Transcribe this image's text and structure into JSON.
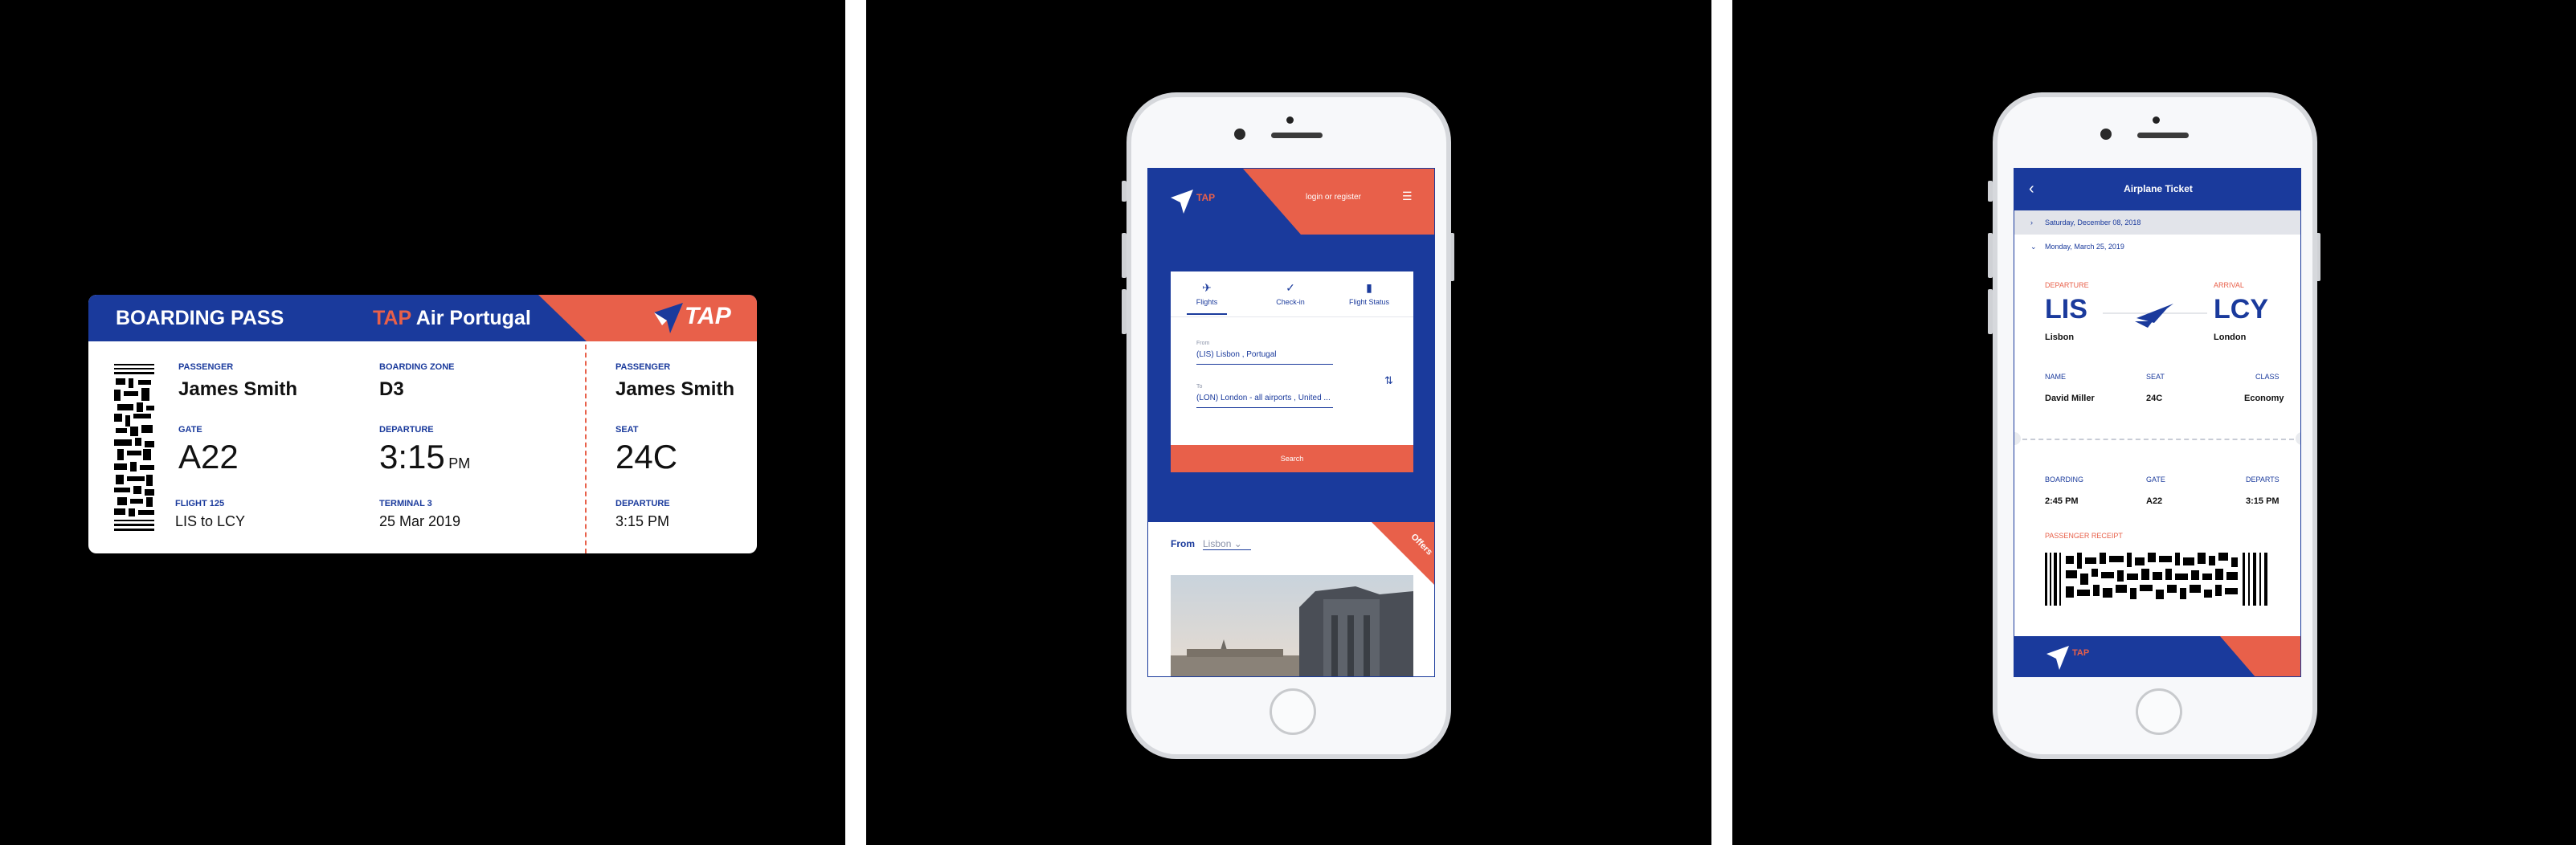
{
  "boarding_pass": {
    "title": "BOARDING PASS",
    "airline_tap": "TAP",
    "airline_rest": " Air Portugal",
    "logo": "TAP",
    "passenger_label": "PASSENGER",
    "passenger": "James Smith",
    "boarding_zone_label": "BOARDING ZONE",
    "boarding_zone": "D3",
    "gate_label": "GATE",
    "gate": "A22",
    "departure_label": "DEPARTURE",
    "departure_time": "3:15",
    "departure_ampm": "PM",
    "flight_label": "FLIGHT 125",
    "route": "LIS to LCY",
    "terminal_label": "TERMINAL 3",
    "date": "25 Mar 2019",
    "stub": {
      "passenger_label": "PASSENGER",
      "passenger": "James Smith",
      "seat_label": "SEAT",
      "seat": "24C",
      "departure_label": "DEPARTURE",
      "departure": "3:15 PM"
    }
  },
  "booking_screen": {
    "logo": "TAP",
    "login": "login or register",
    "menu_icon": "hamburger-menu-icon",
    "tabs": [
      {
        "label": "Flights",
        "icon": "plane-icon"
      },
      {
        "label": "Check-in",
        "icon": "check-circle-icon"
      },
      {
        "label": "Flight Status",
        "icon": "status-bars-icon"
      }
    ],
    "from_label": "From",
    "from_value": "(LIS) Lisbon , Portugal",
    "to_label": "To",
    "to_value": "(LON) London -  all airports , United ...",
    "search": "Search",
    "offers": "Offers",
    "from_heading": "From",
    "from_city": "Lisbon"
  },
  "ticket_screen": {
    "title": "Airplane Ticket",
    "date_collapsed": "Saturday, December 08, 2018",
    "date_expanded": "Monday, March 25, 2019",
    "departure_label": "DEPARTURE",
    "arrival_label": "ARRIVAL",
    "from_code": "LIS",
    "to_code": "LCY",
    "from_city": "Lisbon",
    "to_city": "London",
    "name_label": "NAME",
    "seat_label": "SEAT",
    "class_label": "CLASS",
    "name": "David Miller",
    "seat": "24C",
    "class": "Economy",
    "boarding_label": "BOARDING",
    "gate_label": "GATE",
    "departs_label": "DEPARTS",
    "boarding": "2:45 PM",
    "gate": "A22",
    "departs": "3:15 PM",
    "receipt_label": "PASSENGER RECEIPT",
    "footer_logo": "TAP"
  },
  "colors": {
    "navy": "#1a3a9c",
    "coral": "#e8604a",
    "background": "#000000"
  }
}
